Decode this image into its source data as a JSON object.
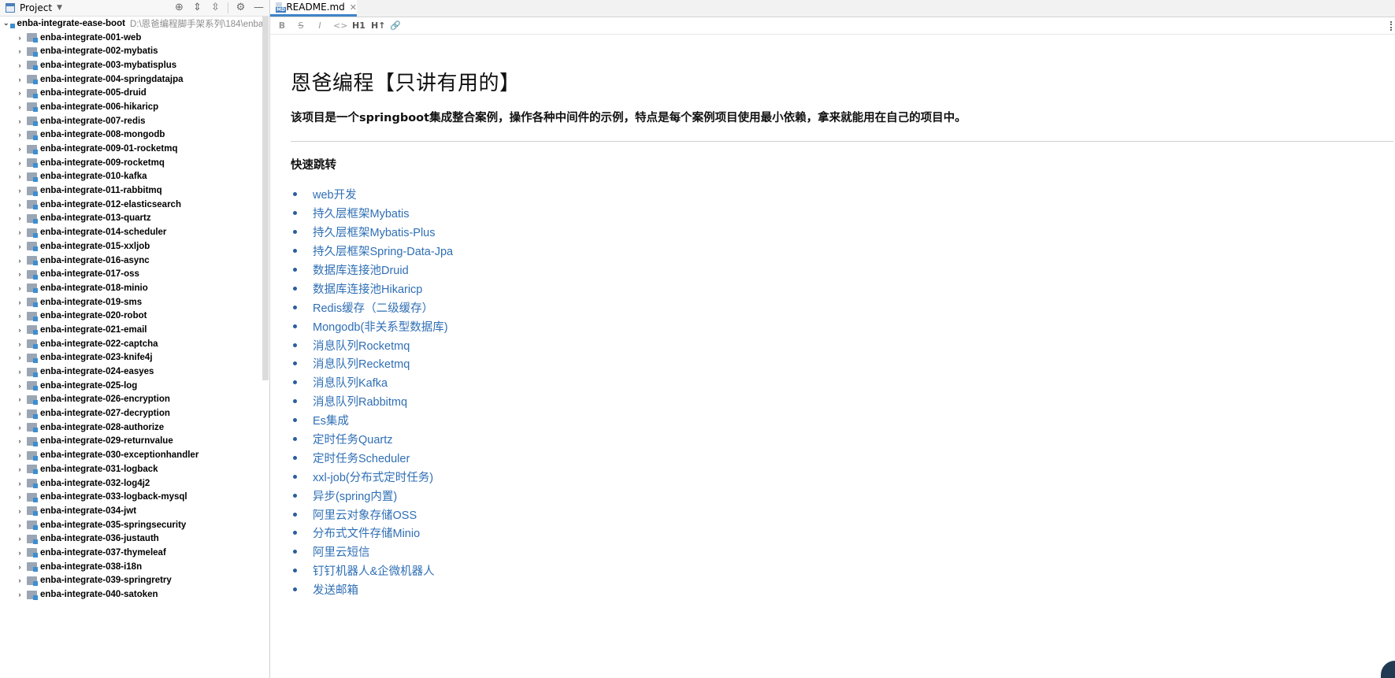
{
  "project_panel": {
    "title": "Project",
    "icons": [
      "locate-icon",
      "expand-all-icon",
      "collapse-all-icon",
      "gear-icon",
      "minimize-icon"
    ],
    "root": {
      "name": "enba-integrate-ease-boot",
      "path": "D:\\恩爸编程脚手架系列\\184\\enba"
    },
    "modules": [
      "enba-integrate-001-web",
      "enba-integrate-002-mybatis",
      "enba-integrate-003-mybatisplus",
      "enba-integrate-004-springdatajpa",
      "enba-integrate-005-druid",
      "enba-integrate-006-hikaricp",
      "enba-integrate-007-redis",
      "enba-integrate-008-mongodb",
      "enba-integrate-009-01-rocketmq",
      "enba-integrate-009-rocketmq",
      "enba-integrate-010-kafka",
      "enba-integrate-011-rabbitmq",
      "enba-integrate-012-elasticsearch",
      "enba-integrate-013-quartz",
      "enba-integrate-014-scheduler",
      "enba-integrate-015-xxljob",
      "enba-integrate-016-async",
      "enba-integrate-017-oss",
      "enba-integrate-018-minio",
      "enba-integrate-019-sms",
      "enba-integrate-020-robot",
      "enba-integrate-021-email",
      "enba-integrate-022-captcha",
      "enba-integrate-023-knife4j",
      "enba-integrate-024-easyes",
      "enba-integrate-025-log",
      "enba-integrate-026-encryption",
      "enba-integrate-027-decryption",
      "enba-integrate-028-authorize",
      "enba-integrate-029-returnvalue",
      "enba-integrate-030-exceptionhandler",
      "enba-integrate-031-logback",
      "enba-integrate-032-log4j2",
      "enba-integrate-033-logback-mysql",
      "enba-integrate-034-jwt",
      "enba-integrate-035-springsecurity",
      "enba-integrate-036-justauth",
      "enba-integrate-037-thymeleaf",
      "enba-integrate-038-i18n",
      "enba-integrate-039-springretry",
      "enba-integrate-040-satoken"
    ]
  },
  "editor": {
    "tab_label": "README.md",
    "toolbar": [
      "B",
      "S",
      "I",
      "<>",
      "H1",
      "H↑",
      "link"
    ],
    "heading": "恩爸编程【只讲有用的】",
    "intro": "该项目是一个springboot集成整合案例，操作各种中间件的示例，特点是每个案例项目使用最小依赖，拿来就能用在自己的项目中。",
    "section_title": "快速跳转",
    "links": [
      "web开发",
      "持久层框架Mybatis",
      "持久层框架Mybatis-Plus",
      "持久层框架Spring-Data-Jpa",
      "数据库连接池Druid",
      "数据库连接池Hikaricp",
      "Redis缓存（二级缓存）",
      "Mongodb(非关系型数据库)",
      "消息队列Rocketmq",
      "消息队列Recketmq",
      "消息队列Kafka",
      "消息队列Rabbitmq",
      "Es集成",
      "定时任务Quartz",
      "定时任务Scheduler",
      "xxl-job(分布式定时任务)",
      "异步(spring内置)",
      "阿里云对象存储OSS",
      "分布式文件存储Minio",
      "阿里云短信",
      "钉钉机器人&企微机器人",
      "发送邮箱"
    ]
  }
}
